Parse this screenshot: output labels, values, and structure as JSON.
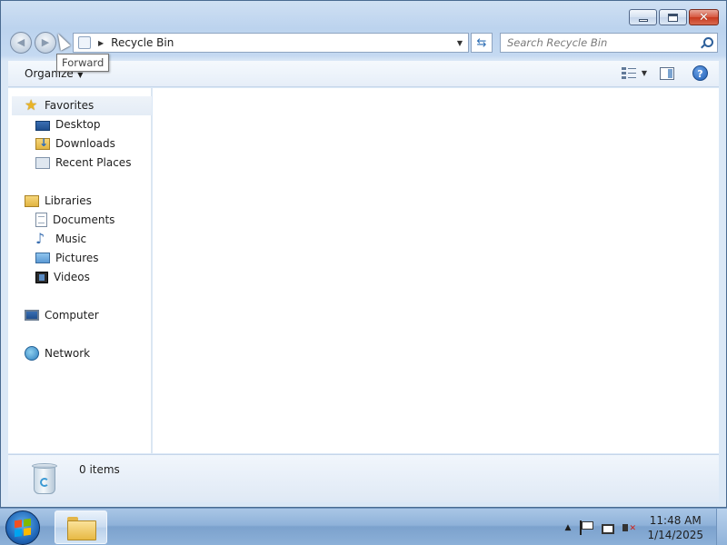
{
  "window": {
    "caption_buttons": [
      "minimize",
      "maximize",
      "close"
    ]
  },
  "nav": {
    "tooltip": "Forward",
    "address": "Recycle Bin",
    "search_placeholder": "Search Recycle Bin"
  },
  "toolbar": {
    "organize_label": "Organize"
  },
  "sidebar": {
    "favorites": {
      "label": "Favorites",
      "icon": "star-icon"
    },
    "favorites_items": [
      {
        "label": "Desktop",
        "icon": "desktop-icon"
      },
      {
        "label": "Downloads",
        "icon": "downloads-icon"
      },
      {
        "label": "Recent Places",
        "icon": "recent-places-icon"
      }
    ],
    "libraries": {
      "label": "Libraries",
      "icon": "libraries-icon"
    },
    "libraries_items": [
      {
        "label": "Documents",
        "icon": "documents-icon"
      },
      {
        "label": "Music",
        "icon": "music-icon"
      },
      {
        "label": "Pictures",
        "icon": "pictures-icon"
      },
      {
        "label": "Videos",
        "icon": "videos-icon"
      }
    ],
    "computer": {
      "label": "Computer",
      "icon": "computer-icon"
    },
    "network": {
      "label": "Network",
      "icon": "network-icon"
    }
  },
  "details": {
    "items_count": "0 items",
    "icon": "recycle-bin-icon"
  },
  "taskbar": {
    "time": "11:48 AM",
    "date": "1/14/2025",
    "pinned": [
      "windows-explorer-icon"
    ]
  },
  "colors": {
    "accent": "#2d5f9a",
    "close_button": "#c8391f",
    "taskbar": "#8fb2d9"
  }
}
